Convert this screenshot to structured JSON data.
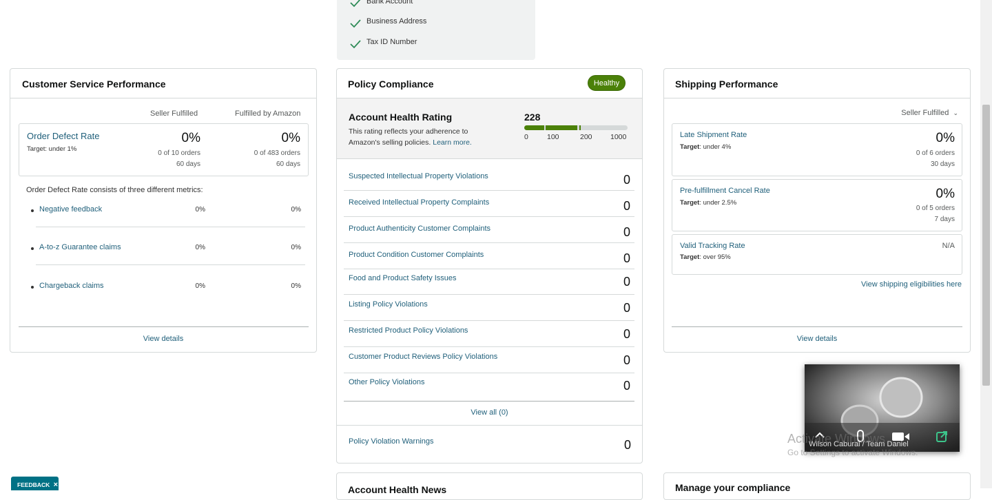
{
  "verification": {
    "items": [
      "Bank Account",
      "Business Address",
      "Tax ID Number"
    ]
  },
  "customer_service": {
    "title": "Customer Service Performance",
    "col_seller": "Seller Fulfilled",
    "col_amazon": "Fulfilled by Amazon",
    "odr": {
      "label": "Order Defect Rate",
      "target_prefix": "Target",
      "target_value": ": under 1%",
      "seller_pct": "0%",
      "seller_orders": "0 of 10 orders",
      "seller_days": "60 days",
      "amazon_pct": "0%",
      "amazon_orders": "0 of 483 orders",
      "amazon_days": "60 days"
    },
    "consists_text": "Order Defect Rate consists of three different metrics:",
    "metrics": [
      {
        "label": "Negative feedback",
        "seller": "0%",
        "amazon": "0%"
      },
      {
        "label": "A-to-z Guarantee claims",
        "seller": "0%",
        "amazon": "0%"
      },
      {
        "label": "Chargeback claims",
        "seller": "0%",
        "amazon": "0%"
      }
    ],
    "view_details": "View details"
  },
  "policy": {
    "title": "Policy Compliance",
    "badge": "Healthy",
    "ahr_title": "Account Health Rating",
    "ahr_desc": "This rating reflects your adherence to Amazon's selling policies.",
    "learn_more": "Learn more.",
    "score": "228",
    "score_value": 228,
    "scale": [
      "0",
      "100",
      "200",
      "1000"
    ],
    "rows": [
      {
        "label": "Suspected Intellectual Property Violations",
        "value": "0"
      },
      {
        "label": "Received Intellectual Property Complaints",
        "value": "0"
      },
      {
        "label": "Product Authenticity Customer Complaints",
        "value": "0"
      },
      {
        "label": "Product Condition Customer Complaints",
        "value": "0"
      },
      {
        "label": "Food and Product Safety Issues",
        "value": "0"
      },
      {
        "label": "Listing Policy Violations",
        "value": "0"
      },
      {
        "label": "Restricted Product Policy Violations",
        "value": "0"
      },
      {
        "label": "Customer Product Reviews Policy Violations",
        "value": "0"
      },
      {
        "label": "Other Policy Violations",
        "value": "0"
      }
    ],
    "view_all": "View all (0)",
    "warnings_label": "Policy Violation Warnings",
    "warnings_value": "0"
  },
  "shipping": {
    "title": "Shipping Performance",
    "filter": "Seller Fulfilled",
    "metrics": [
      {
        "label": "Late Shipment Rate",
        "target_prefix": "Target",
        "target_value": ": under 4%",
        "pct": "0%",
        "orders": "0 of 6 orders",
        "days": "30 days"
      },
      {
        "label": "Pre-fulfillment Cancel Rate",
        "target_prefix": "Target",
        "target_value": ": under 2.5%",
        "pct": "0%",
        "orders": "0 of 5 orders",
        "days": "7 days"
      },
      {
        "label": "Valid Tracking Rate",
        "target_prefix": "Target",
        "target_value": ": over 95%",
        "pct": "N/A"
      }
    ],
    "eligibility_link": "View shipping eligibilities here",
    "view_details": "View details"
  },
  "bottom_cards": {
    "left": "Account Health News",
    "right": "Manage your compliance"
  },
  "feedback": {
    "label": "FEEDBACK",
    "close": "×"
  },
  "video_overlay": {
    "caption": "Wilson Cabural / Team Daniel"
  },
  "watermark": {
    "line1": "Activate Windows",
    "line2": "Go to Settings to activate Windows."
  },
  "colors": {
    "accent": "#1f5f7a",
    "healthy": "#4b8109",
    "bar_green": "#4b8109",
    "bar_grey": "#d5d9d9",
    "check": "#2e8b57",
    "feedback": "#007185"
  }
}
